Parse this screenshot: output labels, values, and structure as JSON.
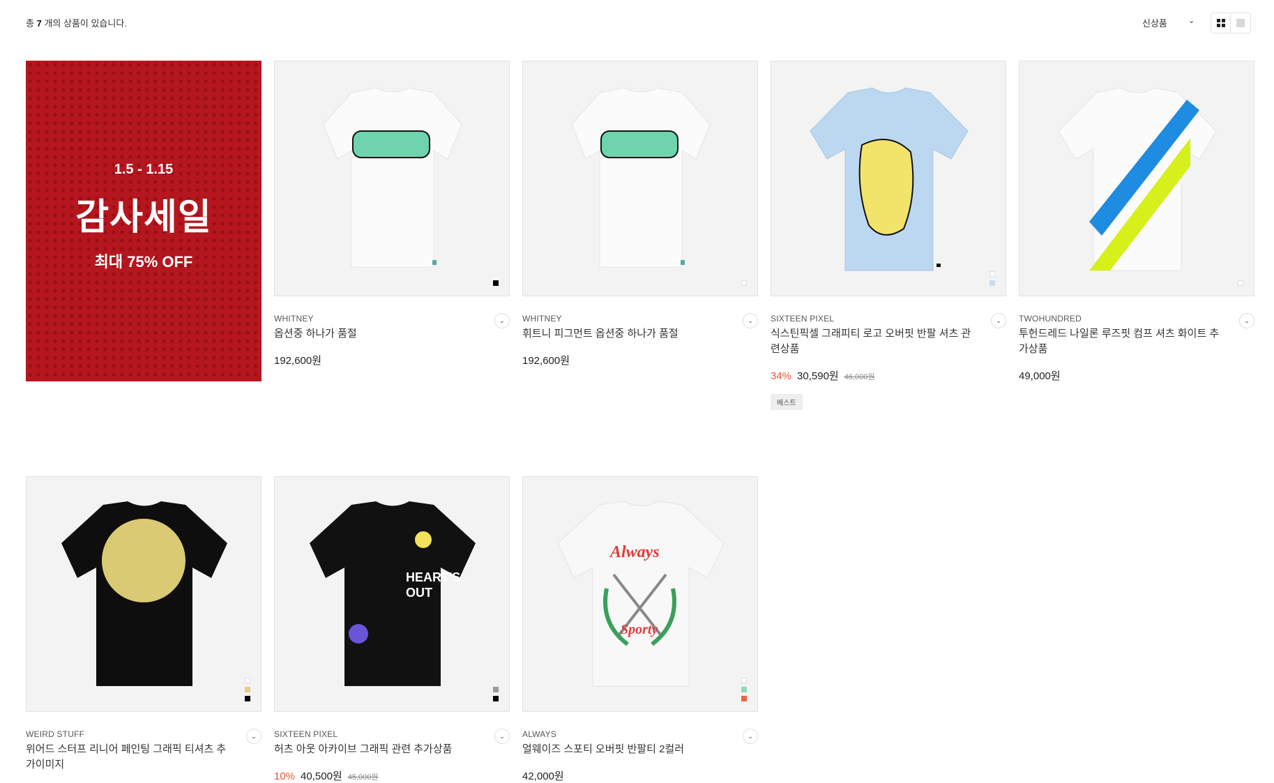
{
  "header": {
    "count_prefix": "총",
    "count_value": "7",
    "count_suffix": "개의 상품이 있습니다.",
    "sort_label": "신상품",
    "view_grid": "grid-view",
    "view_list": "list-view"
  },
  "banner": {
    "date": "1.5 - 1.15",
    "title": "감사세일",
    "subtitle": "최대 75% OFF",
    "bg_color": "#b6171f"
  },
  "products": [
    {
      "brand": "WHITNEY",
      "name": "옵션중 하나가 품절",
      "price": "192,600원",
      "discount": "",
      "original": "",
      "badge": "",
      "swatches": [
        "#000000"
      ]
    },
    {
      "brand": "WHITNEY",
      "name": "휘트니 피그먼트 옵션중 하나가 품절",
      "price": "192,600원",
      "discount": "",
      "original": "",
      "badge": "",
      "swatches": [
        "#ffffff"
      ]
    },
    {
      "brand": "SIXTEEN PIXEL",
      "name": "식스틴픽셀 그래피티 로고 오버핏 반팔 셔츠 관련상품",
      "price": "30,590원",
      "discount": "34%",
      "original": "46,000원",
      "badge": "베스트",
      "swatches": [
        "#ffffff",
        "#c7dcec"
      ]
    },
    {
      "brand": "TWOHUNDRED",
      "name": "투헌드레드 나일론 루즈핏 컴프 셔츠 화이트 추가상품",
      "price": "49,000원",
      "discount": "",
      "original": "",
      "badge": "",
      "swatches": [
        "#ffffff"
      ]
    },
    {
      "brand": "WEIRD STUFF",
      "name": "위어드 스터프 리니어 페인팅 그래픽 티셔츠 추가이미지",
      "price": "",
      "discount": "",
      "original": "",
      "badge": "",
      "swatches": [
        "#ffffff",
        "#e8cf7d",
        "#000000"
      ]
    },
    {
      "brand": "SIXTEEN PIXEL",
      "name": "허츠 아웃 아카이브 그래픽 관련 추가상품",
      "price": "40,500원",
      "discount": "10%",
      "original": "45,000원",
      "badge": "",
      "swatches": [
        "#9a9a9a",
        "#000000"
      ]
    },
    {
      "brand": "ALWAYS",
      "name": "얼웨이즈 스포티 오버핏 반팔티 2컬러",
      "price": "42,000원",
      "discount": "",
      "original": "",
      "badge": "",
      "swatches": [
        "#ffffff",
        "#8fd8b8",
        "#e8654c"
      ]
    }
  ],
  "icons": {
    "more": "chevron-down-icon",
    "grid": "grid-icon",
    "list": "list-icon",
    "sort": "chevron-down-icon"
  }
}
